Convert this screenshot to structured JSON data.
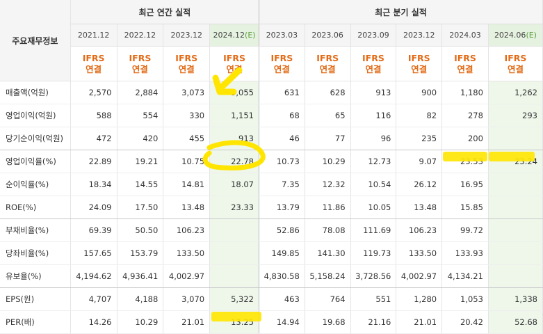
{
  "corner_label": "주요재무정보",
  "groups": {
    "annual": "최근 연간 실적",
    "quarterly": "최근 분기 실적"
  },
  "periods": [
    {
      "label": "2021.12",
      "est": ""
    },
    {
      "label": "2022.12",
      "est": ""
    },
    {
      "label": "2023.12",
      "est": ""
    },
    {
      "label": "2024.12",
      "est": "(E)"
    },
    {
      "label": "2023.03",
      "est": ""
    },
    {
      "label": "2023.06",
      "est": ""
    },
    {
      "label": "2023.09",
      "est": ""
    },
    {
      "label": "2023.12",
      "est": ""
    },
    {
      "label": "2024.03",
      "est": ""
    },
    {
      "label": "2024.06",
      "est": "(E)"
    }
  ],
  "ifrs": {
    "line1": "IFRS",
    "line2": "연결"
  },
  "rows": [
    {
      "label": "매출액(억원)",
      "values": [
        "2,570",
        "2,884",
        "3,073",
        "5,055",
        "631",
        "628",
        "913",
        "900",
        "1,180",
        "1,262"
      ]
    },
    {
      "label": "영업이익(억원)",
      "values": [
        "588",
        "554",
        "330",
        "1,151",
        "68",
        "65",
        "116",
        "82",
        "278",
        "293"
      ]
    },
    {
      "label": "당기순이익(억원)",
      "values": [
        "472",
        "420",
        "455",
        "913",
        "46",
        "77",
        "96",
        "235",
        "200",
        ""
      ]
    },
    {
      "label": "영업이익률(%)",
      "values": [
        "22.89",
        "19.21",
        "10.75",
        "22.78",
        "10.73",
        "10.29",
        "12.73",
        "9.07",
        "23.53",
        "23.24"
      ]
    },
    {
      "label": "순이익률(%)",
      "values": [
        "18.34",
        "14.55",
        "14.81",
        "18.07",
        "7.35",
        "12.32",
        "10.54",
        "26.12",
        "16.95",
        ""
      ]
    },
    {
      "label": "ROE(%)",
      "values": [
        "24.09",
        "17.50",
        "13.48",
        "23.33",
        "13.79",
        "11.86",
        "10.05",
        "13.48",
        "15.85",
        ""
      ]
    },
    {
      "label": "부채비율(%)",
      "values": [
        "69.39",
        "50.50",
        "106.23",
        "",
        "52.86",
        "78.08",
        "111.69",
        "106.23",
        "99.72",
        ""
      ]
    },
    {
      "label": "당좌비율(%)",
      "values": [
        "157.65",
        "153.79",
        "133.50",
        "",
        "149.85",
        "141.30",
        "119.73",
        "133.50",
        "133.93",
        ""
      ]
    },
    {
      "label": "유보율(%)",
      "values": [
        "4,194.62",
        "4,936.41",
        "4,002.97",
        "",
        "4,830.58",
        "5,158.24",
        "3,728.56",
        "4,002.97",
        "4,134.21",
        ""
      ]
    },
    {
      "label": "EPS(원)",
      "values": [
        "4,707",
        "4,188",
        "3,070",
        "5,322",
        "463",
        "764",
        "551",
        "1,280",
        "1,053",
        "1,338"
      ]
    },
    {
      "label": "PER(배)",
      "values": [
        "14.26",
        "10.29",
        "21.01",
        "13.25",
        "14.94",
        "19.68",
        "21.16",
        "21.01",
        "20.42",
        "52.68"
      ]
    }
  ],
  "colors": {
    "highlight": "#ffe500",
    "ifrs_text": "#e26b17",
    "estimate_bg": "#eef7ea",
    "header_bg": "#f5f5f5"
  }
}
